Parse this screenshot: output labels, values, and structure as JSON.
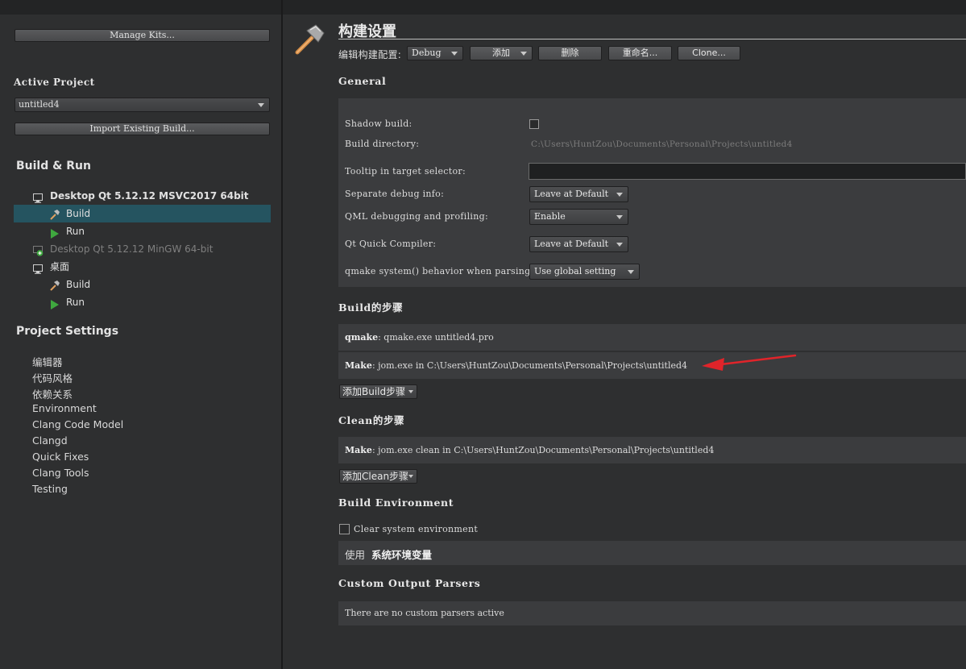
{
  "sidebar": {
    "manage_kits": "Manage Kits...",
    "active_project_heading": "Active Project",
    "project_combo": "untitled4",
    "import_build": "Import Existing Build...",
    "build_run_heading": "Build & Run",
    "kits": [
      {
        "name": "Desktop Qt 5.12.12 MSVC2017 64bit",
        "children": [
          "Build",
          "Run"
        ]
      },
      {
        "name": "Desktop Qt 5.12.12 MinGW 64-bit"
      },
      {
        "name": "桌面",
        "children": [
          "Build",
          "Run"
        ]
      }
    ],
    "project_settings_heading": "Project Settings",
    "settings_items": [
      "编辑器",
      "代码风格",
      "依赖关系",
      "Environment",
      "Clang Code Model",
      "Clangd",
      "Quick Fixes",
      "Clang Tools",
      "Testing"
    ]
  },
  "main": {
    "title": "构建设置",
    "edit_config_label": "编辑构建配置:",
    "config_combo": "Debug",
    "add_button": "添加",
    "delete_button": "删除",
    "rename_button": "重命名...",
    "clone_button": "Clone...",
    "general_heading": "General",
    "general": {
      "shadow_build_label": "Shadow build:",
      "build_dir_label": "Build directory:",
      "build_dir_value": "C:\\Users\\HuntZou\\Documents\\Personal\\Projects\\untitled4",
      "tooltip_label": "Tooltip in target selector:",
      "tooltip_value": "",
      "separate_debug_label": "Separate debug info:",
      "separate_debug_value": "Leave at Default",
      "qml_debug_label": "QML debugging and profiling:",
      "qml_debug_value": "Enable",
      "qt_quick_label": "Qt Quick Compiler:",
      "qt_quick_value": "Leave at Default",
      "qmake_system_label": "qmake system() behavior when parsing:",
      "qmake_system_value": "Use global setting"
    },
    "build_steps_heading": "Build的步骤",
    "build_steps": [
      {
        "name": "qmake",
        "detail": ": qmake.exe untitled4.pro"
      },
      {
        "name": "Make",
        "detail": ": jom.exe in C:\\Users\\HuntZou\\Documents\\Personal\\Projects\\untitled4"
      }
    ],
    "add_build_step": "添加Build步骤",
    "clean_steps_heading": "Clean的步骤",
    "clean_steps": [
      {
        "name": "Make",
        "detail": ": jom.exe clean in C:\\Users\\HuntZou\\Documents\\Personal\\Projects\\untitled4"
      }
    ],
    "add_clean_step": "添加Clean步骤",
    "build_env_heading": "Build Environment",
    "clear_env_label": "Clear system environment",
    "use_env_prefix": "使用",
    "use_env_value": "系统环境变量",
    "custom_parsers_heading": "Custom Output Parsers",
    "custom_parsers_text": "There are no custom parsers active"
  },
  "colors": {
    "selected_row": "#255460",
    "annotation_arrow": "#e0242a",
    "run_icon": "#3fa83f"
  }
}
